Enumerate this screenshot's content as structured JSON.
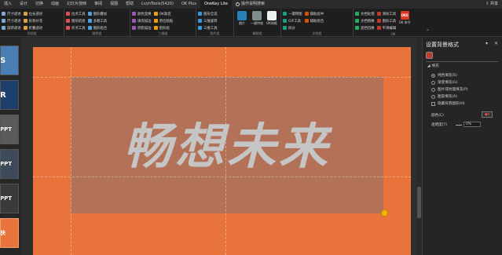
{
  "tabs": [
    "插入",
    "设计",
    "切换",
    "动画",
    "幻灯片放映",
    "审阅",
    "视图",
    "帮助",
    "LvyhTools(5420)",
    "OK Plus",
    "OneKey Lite"
  ],
  "active_tab_index": 10,
  "tell_me": "操作说明搜索",
  "share": "共享",
  "ribbon": {
    "groups": [
      {
        "label": "形状组",
        "items": [
          "尺寸递进",
          "尺寸递进",
          "旋转递进",
          "拉长递进",
          "形状补充",
          "折叠递进"
        ]
      },
      {
        "label": "颜色组",
        "items": [
          "拉点工具",
          "图形结组",
          "折点工具",
          "图形叠加",
          "多图工具",
          "图形组合"
        ]
      },
      {
        "label": "三维组",
        "items": [
          "颜色变换",
          "填充描边",
          "阴影描边",
          "OK渐变",
          "原位粘贴",
          "矩形组"
        ]
      },
      {
        "label": "图片组",
        "items": [
          "图形全选",
          "三维旋转",
          "三维工具"
        ]
      },
      {
        "label": "辅助组",
        "items": [
          "图片",
          "一键特效",
          "OK网格"
        ]
      },
      {
        "label": "文档组",
        "items": [
          "一键转图",
          "GIF工具",
          "拆分",
          "辅助居中",
          "辅助组合",
          "辅助组"
        ]
      },
      {
        "label": "OK",
        "items": [
          "文档处理",
          "文档替换",
          "遮挡切换",
          "清除工具",
          "图形工具",
          "平滑编辑"
        ]
      }
    ],
    "ok_badge": "OKE",
    "ok_label": "OK 命令"
  },
  "thumbnails": [
    {
      "text": "S",
      "bg": "#4a7fb5"
    },
    {
      "text": "R",
      "bg": "#1e3f6e"
    },
    {
      "text": "PPT",
      "bg": "#5a5a5a"
    },
    {
      "text": "PPT",
      "bg": "#3d4a5a"
    },
    {
      "text": "PPT",
      "bg": "#3a3a3a"
    },
    {
      "text": "快",
      "bg": "#e8743b"
    }
  ],
  "slide": {
    "text": "畅想未来",
    "bg": "#e8743b",
    "rect_color": "#b0725a",
    "text_color": "#c5c5c5"
  },
  "pane": {
    "title": "设置背景格式",
    "section": "填充",
    "fill_options": [
      {
        "label": "纯色填充(S)",
        "checked": true
      },
      {
        "label": "渐变填充(G)",
        "checked": false
      },
      {
        "label": "图片或纹理填充(P)",
        "checked": false
      },
      {
        "label": "图案填充(A)",
        "checked": false
      }
    ],
    "hide_bg": "隐藏背景图形(H)",
    "color_label": "颜色(C)",
    "transparency_label": "透明度(T)",
    "transparency_value": "0%"
  }
}
